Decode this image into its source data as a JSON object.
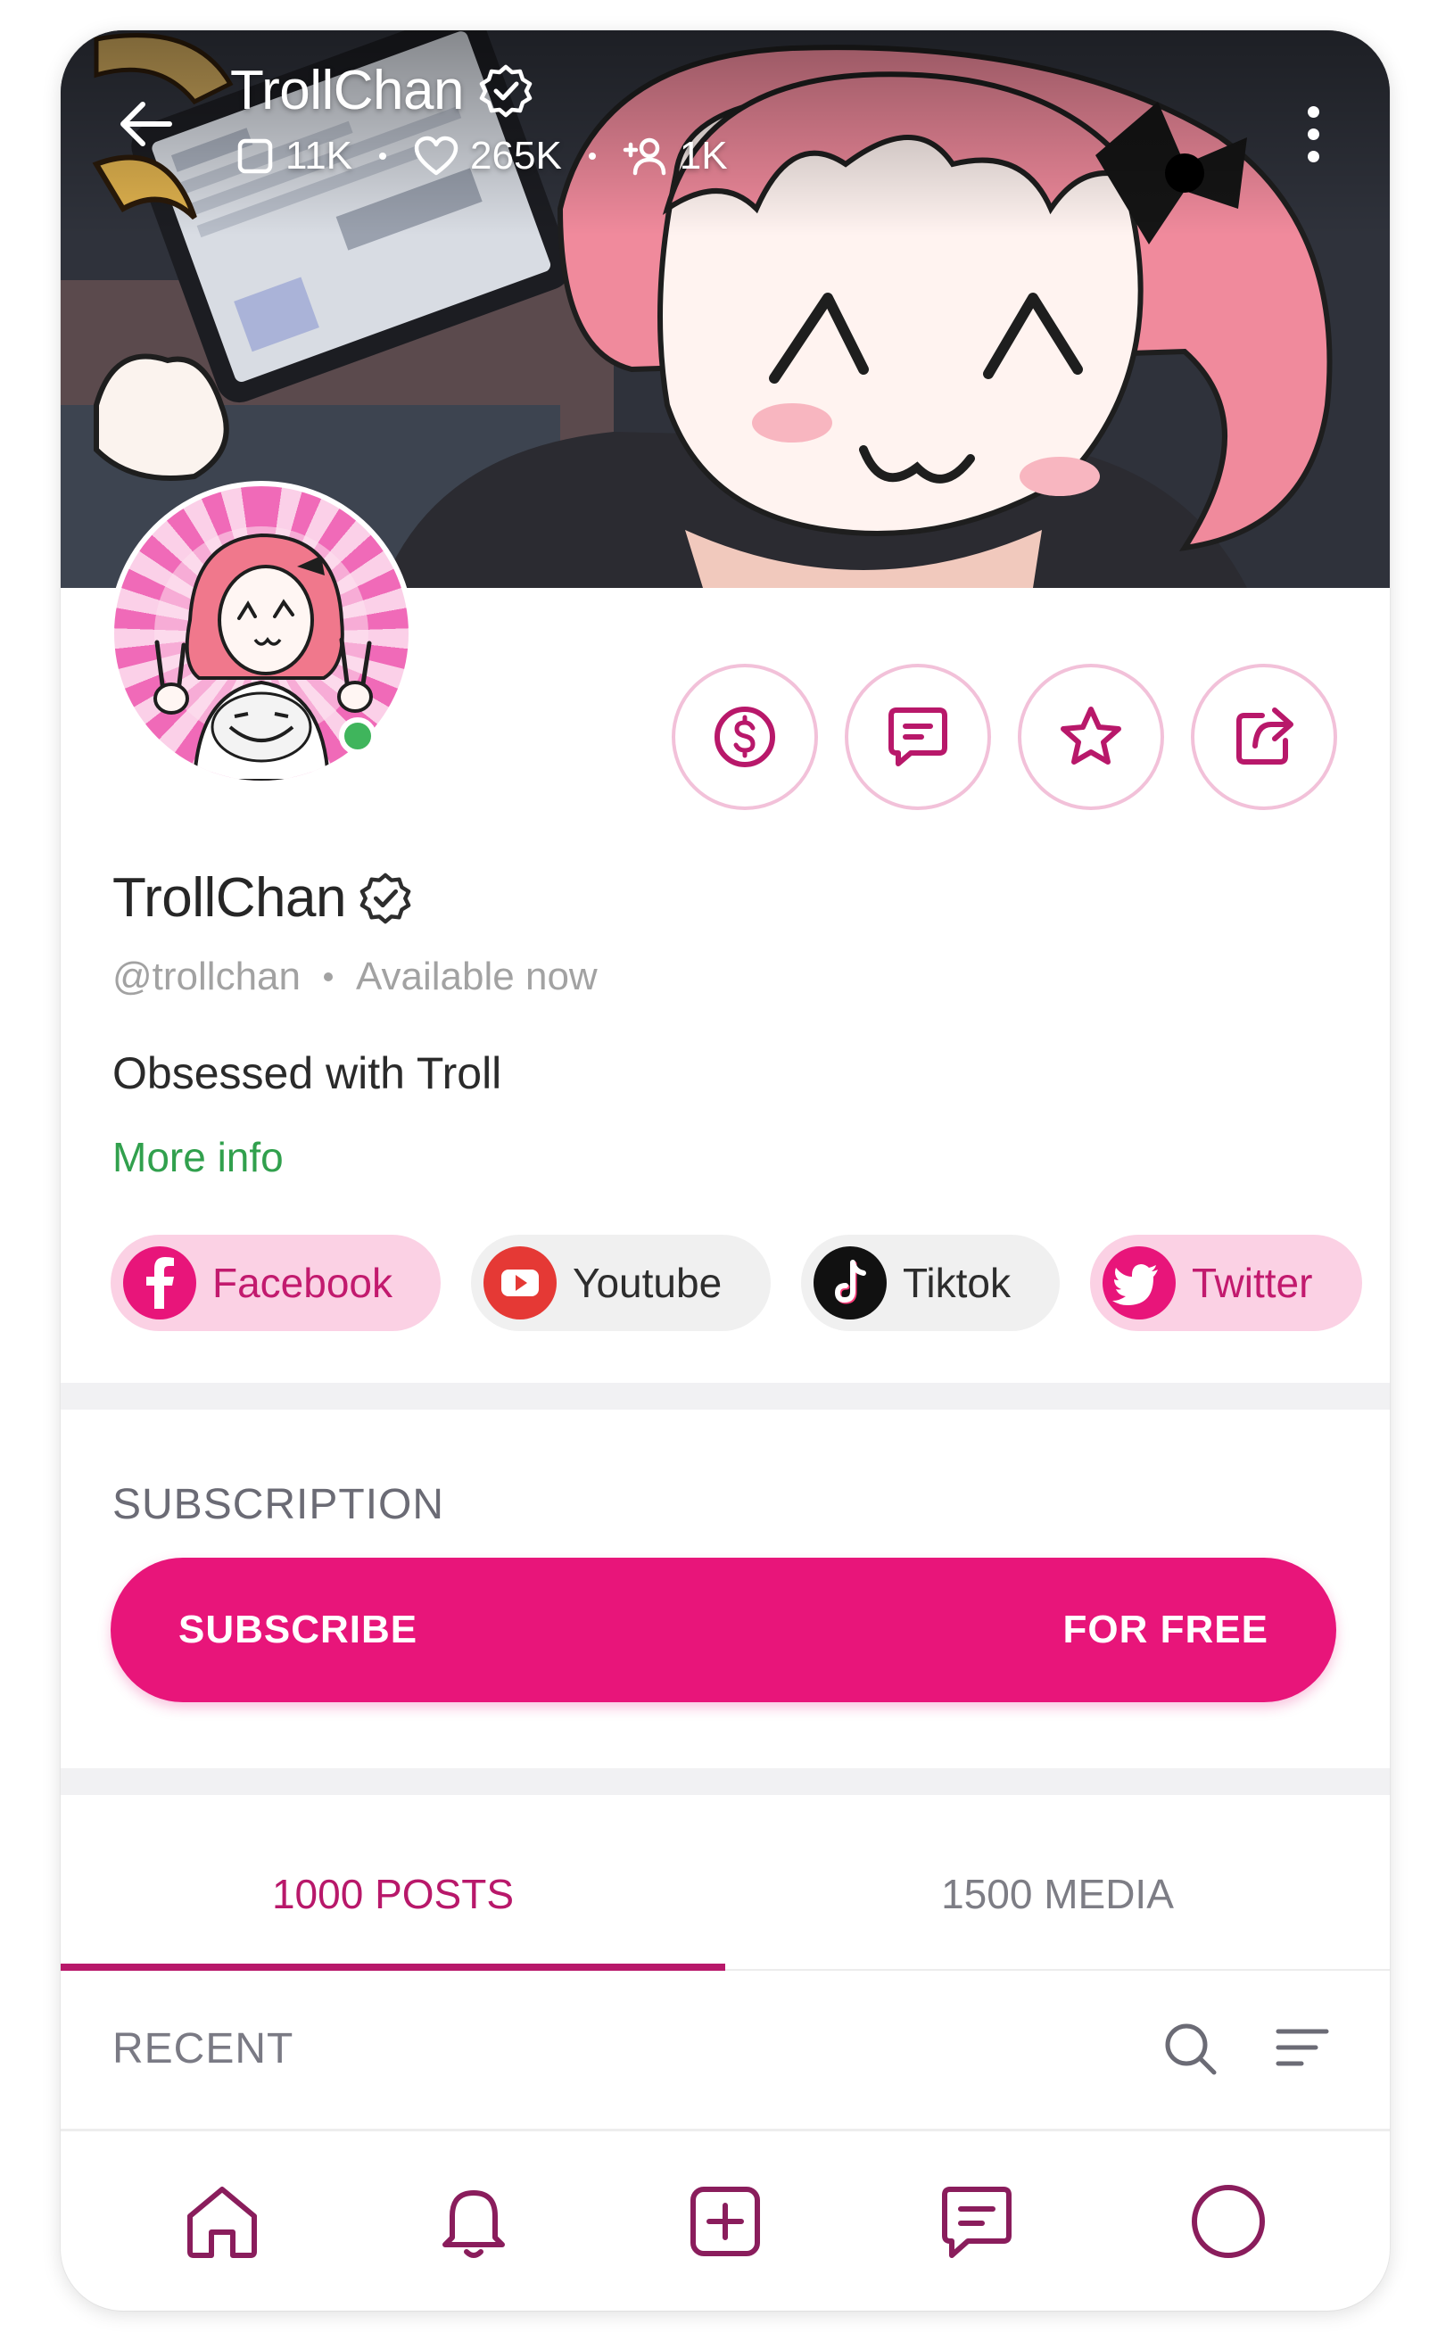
{
  "header": {
    "title": "TrollChan",
    "stats": [
      {
        "icon": "post-square-icon",
        "value": "11K"
      },
      {
        "icon": "heart-icon",
        "value": "265K"
      },
      {
        "icon": "add-user-icon",
        "value": "1K"
      }
    ]
  },
  "profile": {
    "name": "TrollChan",
    "handle": "@trollchan",
    "availability": "Available now",
    "bio": "Obsessed with Troll",
    "more_info": "More info",
    "online": true
  },
  "actions": [
    {
      "name": "tip-button",
      "icon": "dollar-coin-icon"
    },
    {
      "name": "message-button",
      "icon": "message-icon"
    },
    {
      "name": "favorite-button",
      "icon": "star-icon"
    },
    {
      "name": "share-button",
      "icon": "share-icon"
    }
  ],
  "socials": [
    {
      "key": "facebook",
      "label": "Facebook",
      "icon": "facebook-icon"
    },
    {
      "key": "youtube",
      "label": "Youtube",
      "icon": "youtube-icon"
    },
    {
      "key": "tiktok",
      "label": "Tiktok",
      "icon": "tiktok-icon"
    },
    {
      "key": "twitter",
      "label": "Twitter",
      "icon": "twitter-icon"
    }
  ],
  "subscription": {
    "title": "SUBSCRIPTION",
    "button_left": "SUBSCRIBE",
    "button_right": "FOR FREE"
  },
  "tabs": [
    {
      "label": "1000 POSTS",
      "active": true
    },
    {
      "label": "1500 MEDIA",
      "active": false
    }
  ],
  "recent": {
    "label": "RECENT"
  },
  "bottom_nav": [
    "home-icon",
    "bell-icon",
    "add-post-icon",
    "messages-icon",
    "profile-circle-icon"
  ],
  "colors": {
    "accent": "#e8157a",
    "accent_dark": "#b8186a",
    "link_green": "#31a04d",
    "online_green": "#3fb55c"
  }
}
